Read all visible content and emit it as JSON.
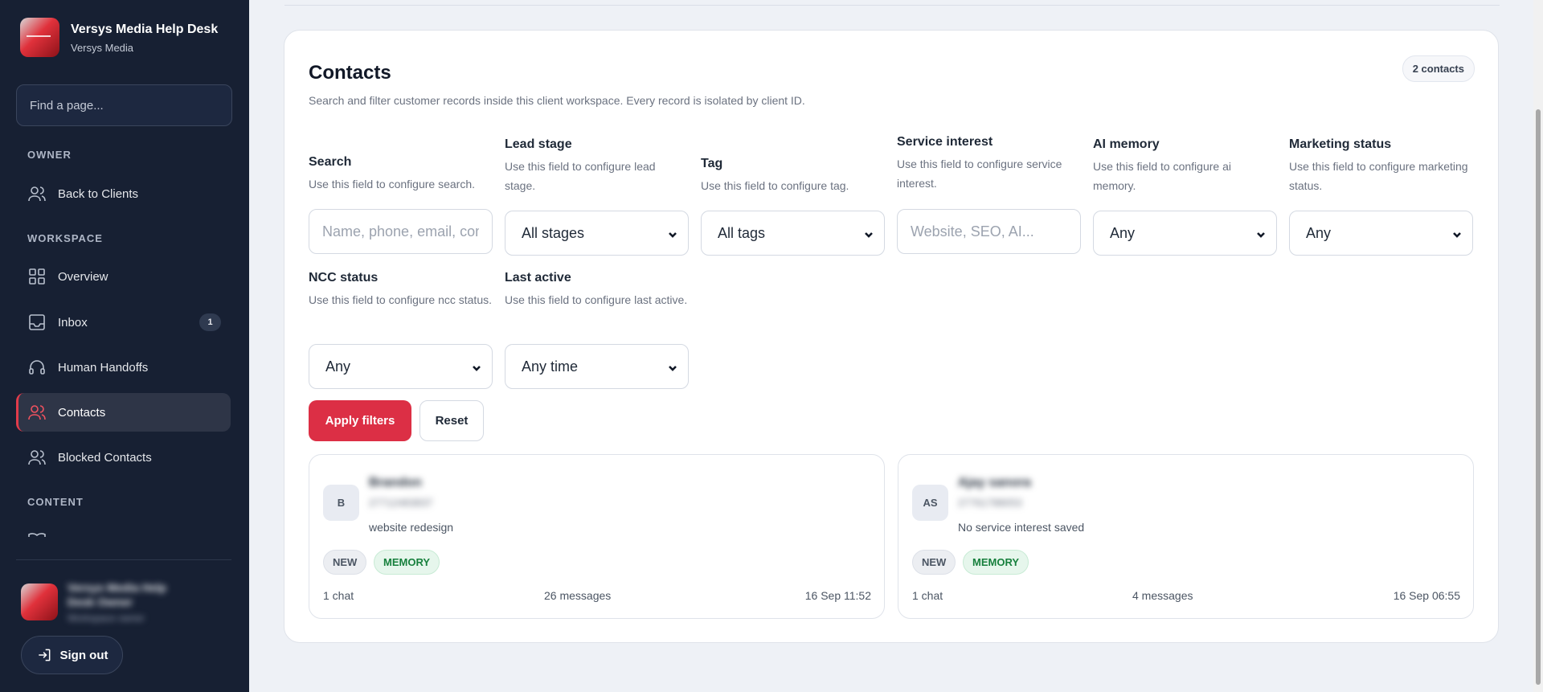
{
  "sidebar": {
    "brand_title": "Versys Media Help Desk",
    "brand_sub": "Versys Media",
    "find_placeholder": "Find a page...",
    "sections": {
      "owner": "OWNER",
      "workspace": "WORKSPACE",
      "content": "CONTENT"
    },
    "items": {
      "back": "Back to Clients",
      "overview": "Overview",
      "inbox": "Inbox",
      "inbox_badge": "1",
      "handoffs": "Human Handoffs",
      "contacts": "Contacts",
      "blocked": "Blocked Contacts"
    },
    "user": {
      "name": "Versys Media Help Desk Owner",
      "role": "Workspace owner"
    },
    "signout": "Sign out",
    "active_color": "#e23b4b"
  },
  "main": {
    "title": "Contacts",
    "description": "Search and filter customer records inside this client workspace. Every record is isolated by client ID.",
    "count": "2 contacts",
    "filters": {
      "search": {
        "label": "Search",
        "help": "Use this field to configure search.",
        "placeholder": "Name, phone, email, company"
      },
      "lead_stage": {
        "label": "Lead stage",
        "help": "Use this field to configure lead stage.",
        "value": "All stages"
      },
      "tag": {
        "label": "Tag",
        "help": "Use this field to configure tag.",
        "value": "All tags"
      },
      "service_interest": {
        "label": "Service interest",
        "help": "Use this field to configure service interest.",
        "placeholder": "Website, SEO, AI..."
      },
      "ai_memory": {
        "label": "AI memory",
        "help": "Use this field to configure ai memory.",
        "value": "Any"
      },
      "marketing_status": {
        "label": "Marketing status",
        "help": "Use this field to configure marketing status.",
        "value": "Any"
      },
      "ncc_status": {
        "label": "NCC status",
        "help": "Use this field to configure ncc status.",
        "value": "Any"
      },
      "last_active": {
        "label": "Last active",
        "help": "Use this field to configure last active.",
        "value": "Any time"
      }
    },
    "apply_label": "Apply filters",
    "reset_label": "Reset",
    "accent_color": "#dc2f45",
    "contacts": [
      {
        "initials": "B",
        "name": "Brandon",
        "phone": "27712483837",
        "interest": "website redesign",
        "tags": [
          "NEW",
          "MEMORY"
        ],
        "chats": "1 chat",
        "messages": "26 messages",
        "last": "16 Sep 11:52"
      },
      {
        "initials": "AS",
        "name": "Ajay sanora",
        "phone": "27761788053",
        "interest": "No service interest saved",
        "tags": [
          "NEW",
          "MEMORY"
        ],
        "chats": "1 chat",
        "messages": "4 messages",
        "last": "16 Sep 06:55"
      }
    ]
  }
}
